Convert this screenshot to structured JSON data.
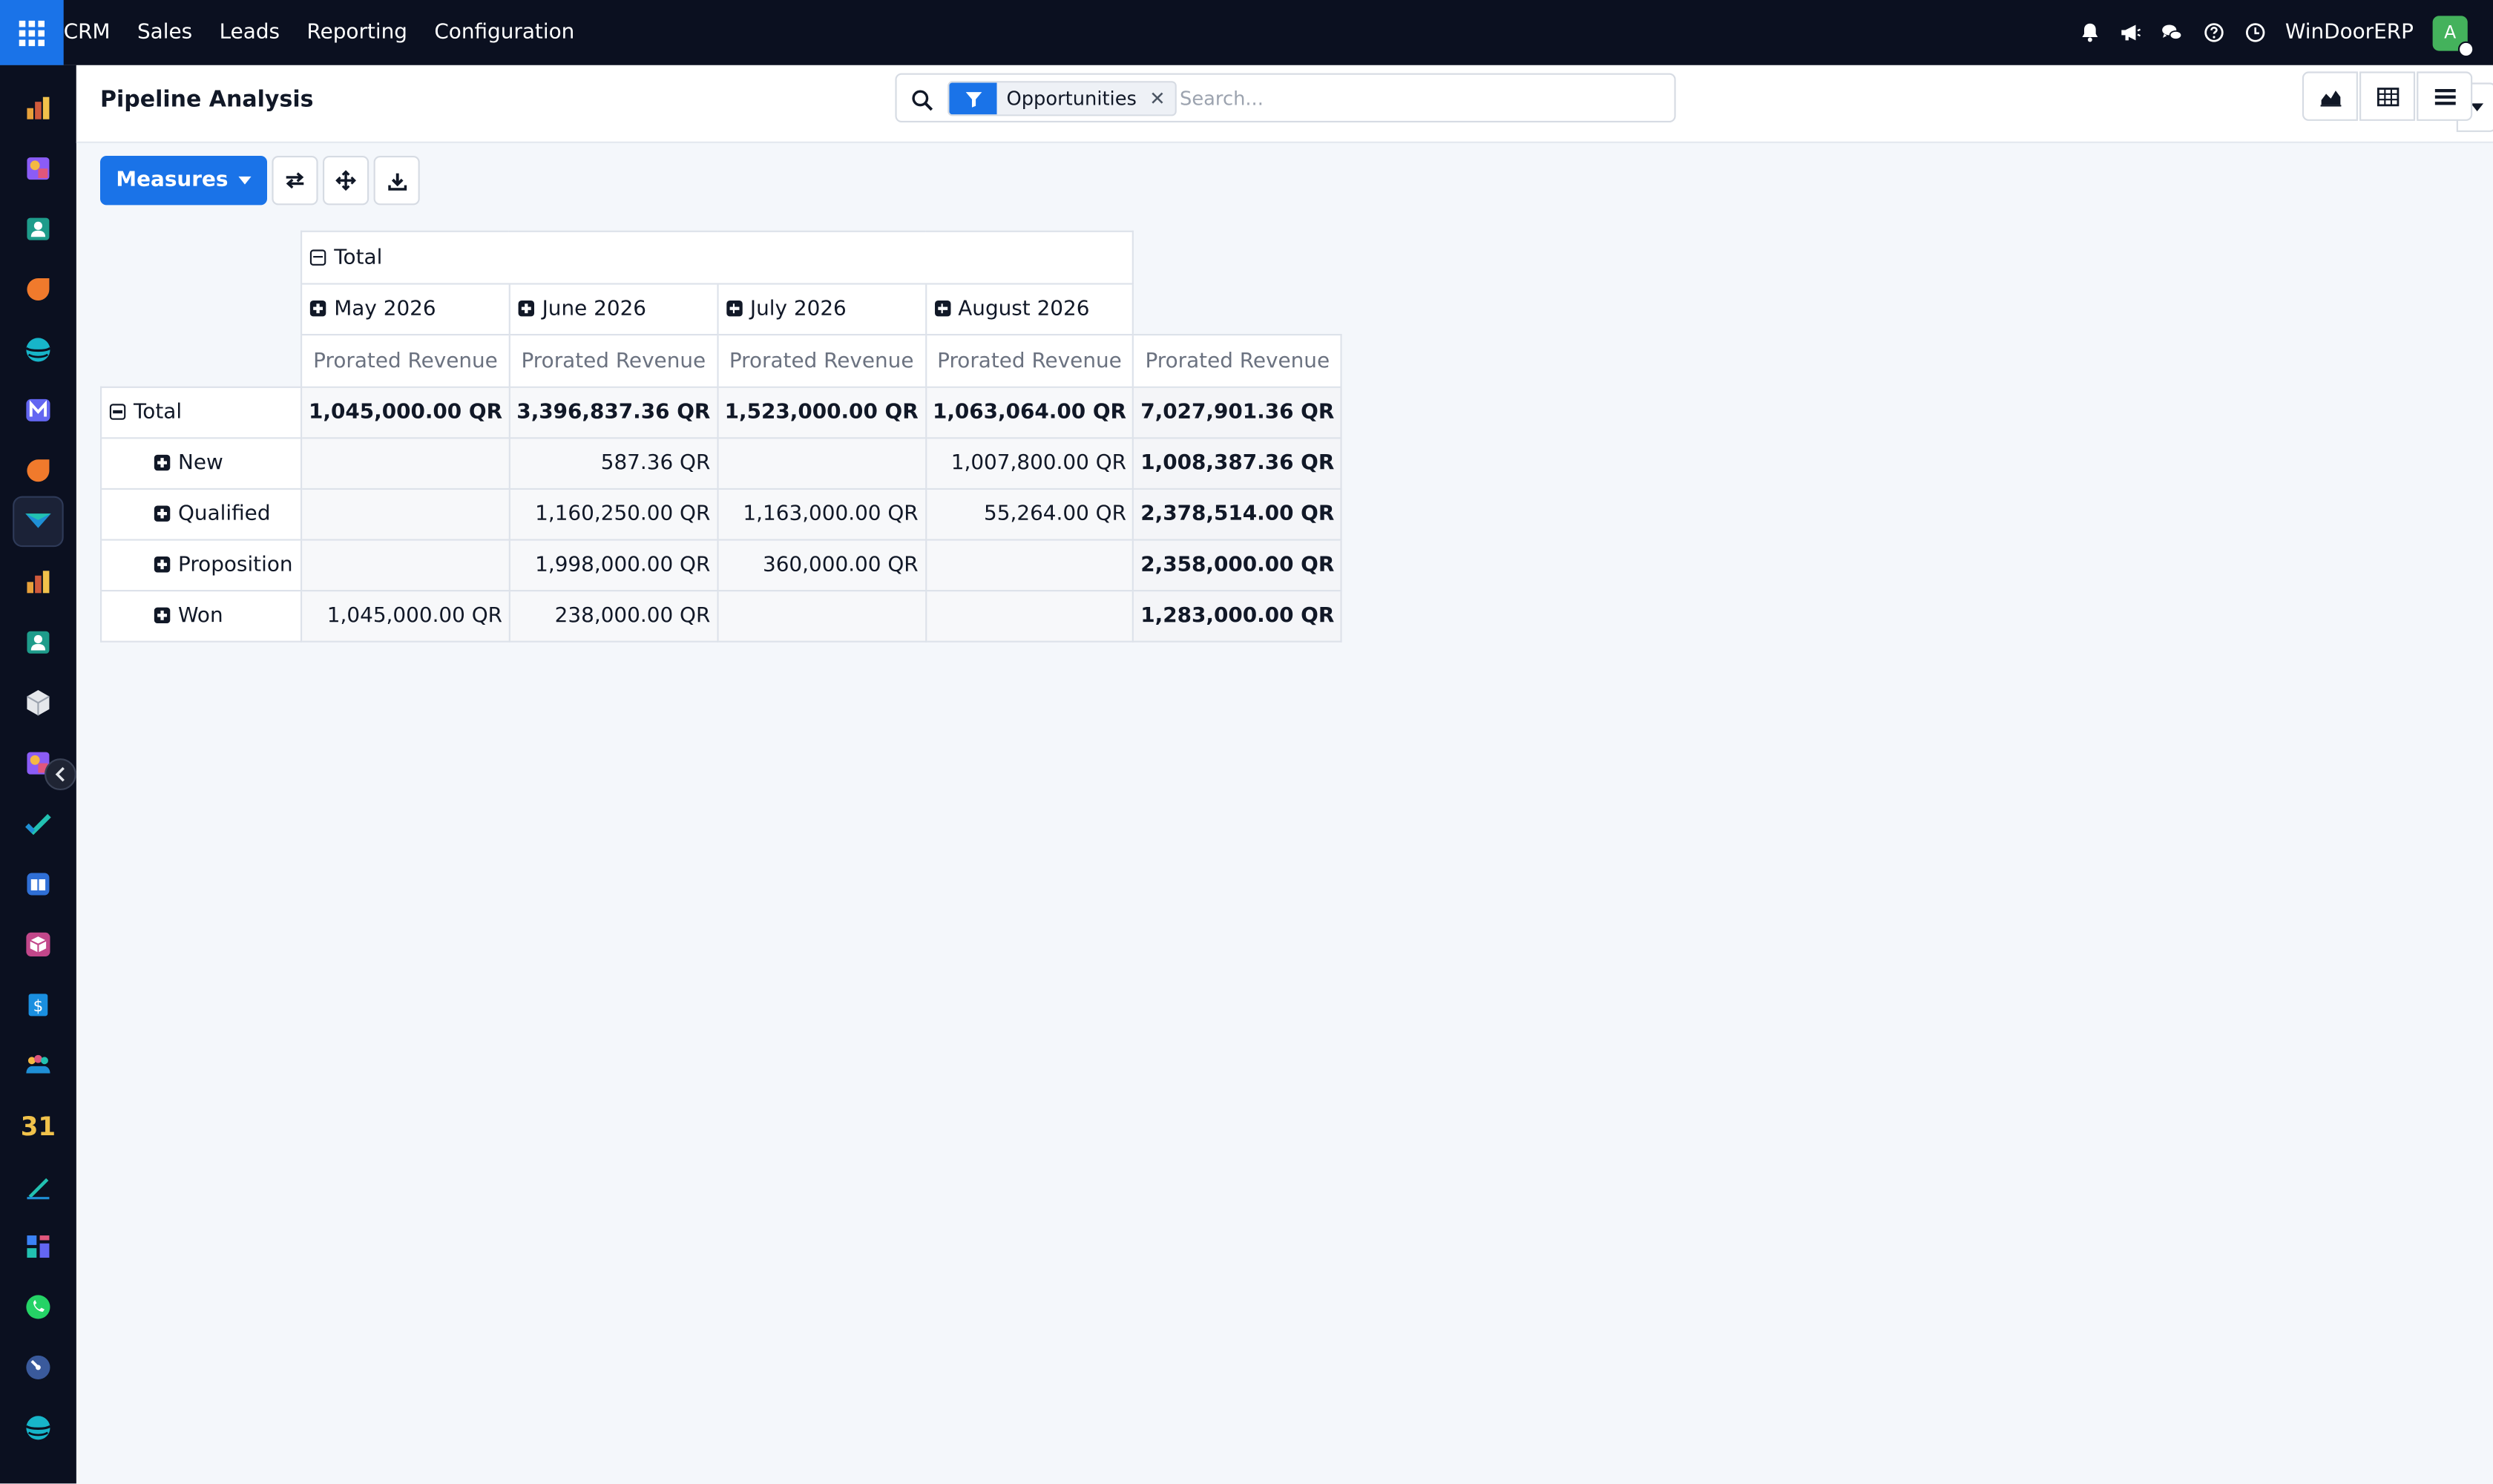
{
  "navbar": {
    "menu": [
      "CRM",
      "Sales",
      "Leads",
      "Reporting",
      "Configuration"
    ],
    "company": "WinDoorERP",
    "avatar_initial": "A",
    "icons": [
      "bell-icon",
      "megaphone-icon",
      "chat-icon",
      "help-icon",
      "clock-icon"
    ]
  },
  "sidebar": {
    "apps": [
      "bar-chart-app",
      "puzzle-app",
      "contacts-app",
      "crm-app",
      "sphere-app",
      "mail-app",
      "discuss-app",
      "pipeline-app",
      "charts-app",
      "contacts-app-2",
      "cube-app",
      "tools-app",
      "check-app",
      "knowledge-app",
      "inventory-app",
      "invoice-app",
      "employees-app",
      "calendar-app",
      "sign-app",
      "dashboard-app",
      "whatsapp-app",
      "timer-app",
      "globe-app"
    ],
    "active_index": 7
  },
  "control": {
    "title": "Pipeline Analysis",
    "facet_value": "Opportunities",
    "search_placeholder": "Search..."
  },
  "pivot_buttons": {
    "measures_label": "Measures"
  },
  "pivot": {
    "column_group": "Total",
    "columns": [
      "May 2026",
      "June 2026",
      "July 2026",
      "August 2026"
    ],
    "measure_label": "Prorated Revenue",
    "total_row": {
      "label": "Total",
      "values": [
        "1,045,000.00 QR",
        "3,396,837.36 QR",
        "1,523,000.00 QR",
        "1,063,064.00 QR"
      ],
      "total": "7,027,901.36 QR"
    },
    "rows": [
      {
        "label": "New",
        "values": [
          "",
          "587.36 QR",
          "",
          "1,007,800.00 QR"
        ],
        "total": "1,008,387.36 QR"
      },
      {
        "label": "Qualified",
        "values": [
          "",
          "1,160,250.00 QR",
          "1,163,000.00 QR",
          "55,264.00 QR"
        ],
        "total": "2,378,514.00 QR"
      },
      {
        "label": "Proposition",
        "values": [
          "",
          "1,998,000.00 QR",
          "360,000.00 QR",
          ""
        ],
        "total": "2,358,000.00 QR"
      },
      {
        "label": "Won",
        "values": [
          "1,045,000.00 QR",
          "238,000.00 QR",
          "",
          ""
        ],
        "total": "1,283,000.00 QR"
      }
    ]
  },
  "colors": {
    "navbar_bg": "#0b1020",
    "accent": "#1a73e8",
    "page_bg": "#f4f7fb"
  }
}
